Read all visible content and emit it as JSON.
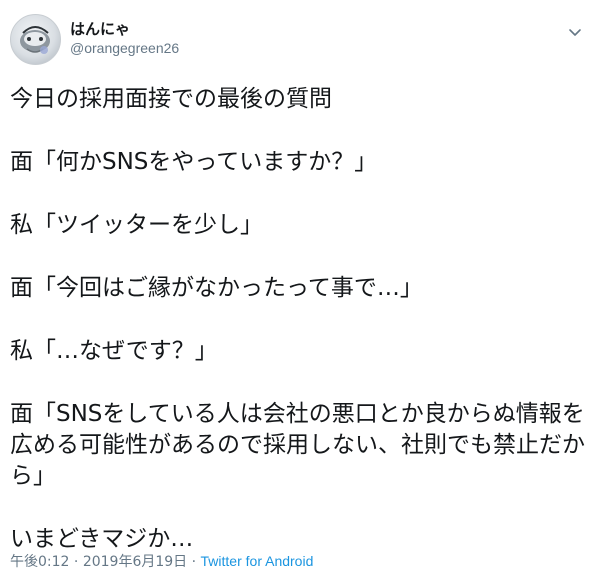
{
  "author": {
    "display_name": "はんにゃ",
    "handle": "@orangegreen26",
    "avatar_icon": "profile-avatar-icon"
  },
  "menu_icon": "chevron-down-icon",
  "tweet": {
    "lines": [
      "今日の採用面接での最後の質問",
      "",
      "面「何かSNSをやっていますか？」",
      "",
      "私「ツイッターを少し」",
      "",
      "面「今回はご縁がなかったって事で…」",
      "",
      "私「…なぜです？」",
      "",
      "面「SNSをしている人は会社の悪口とか良からぬ情報を広める可能性があるので採用しない、社則でも禁止だから」",
      "",
      "いまどきマジか…"
    ]
  },
  "meta": {
    "time": "午後0:12",
    "separator1": " · ",
    "date": "2019年6月19日",
    "separator2": " · ",
    "source": "Twitter for Android"
  },
  "colors": {
    "text": "#14171a",
    "secondary": "#657786",
    "link": "#1b95e0"
  }
}
